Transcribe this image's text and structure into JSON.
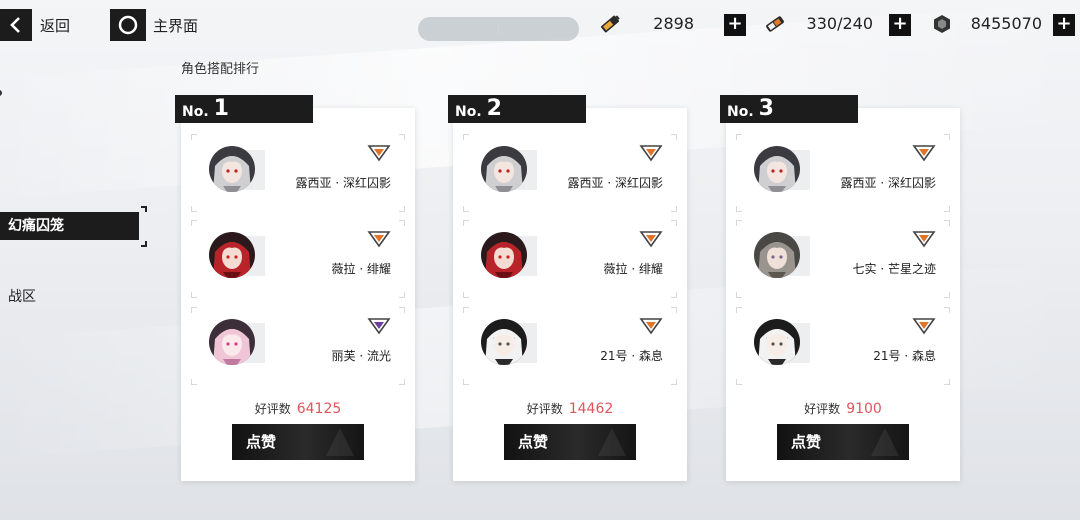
{
  "topbar": {
    "back_label": "返回",
    "home_label": "主界面",
    "status_pill": [
      "",
      ""
    ]
  },
  "resources": [
    {
      "icon": "battery-icon",
      "value": "2898"
    },
    {
      "icon": "stamina-ticket-icon",
      "value": "330/240"
    },
    {
      "icon": "currency-coin-icon",
      "value": "8455070"
    }
  ],
  "sidebar": {
    "active_item": "幻痛囚笼",
    "items": [
      "战区"
    ]
  },
  "section_title": "角色搭配排行",
  "likes_label": "好评数",
  "like_button_label": "点赞",
  "rank_prefix": "No.",
  "rankings": [
    {
      "rank": "1",
      "likes": "64125",
      "characters": [
        {
          "name": "露西亚 · 深红囚影",
          "avatar": "silver-hair",
          "role_color": "#e0742a"
        },
        {
          "name": "薇拉 · 绯耀",
          "avatar": "red-hair",
          "role_color": "#e0742a"
        },
        {
          "name": "丽芙 · 流光",
          "avatar": "pink-hair",
          "role_color": "#6a3fa0"
        }
      ]
    },
    {
      "rank": "2",
      "likes": "14462",
      "characters": [
        {
          "name": "露西亚 · 深红囚影",
          "avatar": "silver-hair",
          "role_color": "#e0742a"
        },
        {
          "name": "薇拉 · 绯耀",
          "avatar": "red-hair",
          "role_color": "#e0742a"
        },
        {
          "name": "21号 · 森息",
          "avatar": "white-hair",
          "role_color": "#e0742a"
        }
      ]
    },
    {
      "rank": "3",
      "likes": "9100",
      "characters": [
        {
          "name": "露西亚 · 深红囚影",
          "avatar": "silver-hair",
          "role_color": "#e0742a"
        },
        {
          "name": "七实 · 芒星之迹",
          "avatar": "gray-hair",
          "role_color": "#e0742a"
        },
        {
          "name": "21号 · 森息",
          "avatar": "white-hair",
          "role_color": "#e0742a"
        }
      ]
    }
  ]
}
